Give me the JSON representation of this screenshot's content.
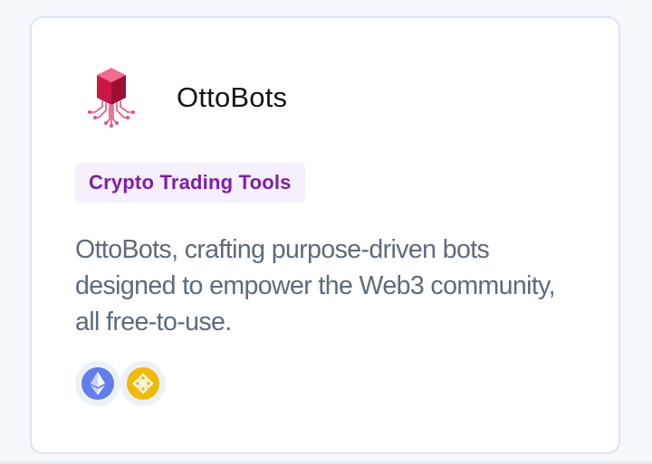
{
  "card": {
    "title": "OttoBots",
    "category": "Crypto Trading Tools",
    "description": "OttoBots, crafting purpose-driven bots designed to empower the Web3 community, all free-to-use.",
    "logo_icon": "ottobots-cube-circuit-logo",
    "chains": [
      {
        "name": "ethereum-icon",
        "color": "#627eea"
      },
      {
        "name": "bnb-chain-icon",
        "color": "#f0b90b"
      }
    ]
  },
  "colors": {
    "category_text": "#7e1fa6",
    "category_bg": "#f6effc",
    "description_text": "#5e6a7b",
    "card_border": "#dde3f3"
  }
}
